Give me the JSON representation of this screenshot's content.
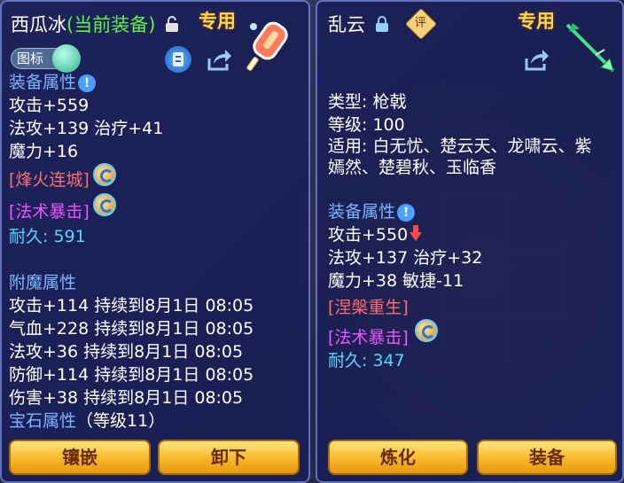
{
  "left_panel": {
    "title_name": "西瓜冰",
    "title_tag": "(当前装备)",
    "special_label": "专用",
    "chip_label": "图标",
    "section_attr": "装备属性",
    "stats": [
      "攻击+559",
      "法攻+139 治疗+41",
      "魔力+16"
    ],
    "skills": [
      "[烽火连城]",
      "[法术暴击]"
    ],
    "durability_label": "耐久:",
    "durability_value": "591",
    "section_enchant": "附魔属性",
    "enchants": [
      "攻击+114 持续到8月1日 08:05",
      "气血+228 持续到8月1日 08:05",
      "法攻+36 持续到8月1日 08:05",
      "防御+114 持续到8月1日 08:05",
      "伤害+38 持续到8月1日 08:05"
    ],
    "gem_label": "宝石属性",
    "gem_level": "（等级11）",
    "buttons": [
      "镶嵌",
      "卸下"
    ]
  },
  "right_panel": {
    "title_name": "乱云",
    "rating_badge": "评",
    "special_label": "专用",
    "type_line": "类型: 枪戟",
    "level_line": "等级: 100",
    "applies_line1": "适用: 白无忧、楚云天、龙啸云、紫",
    "applies_line2": "嫣然、楚碧秋、玉临香",
    "section_attr": "装备属性",
    "stats": [
      "攻击+550",
      "法攻+137 治疗+32",
      "魔力+38 敏捷-11"
    ],
    "skills": [
      "[涅槃重生]",
      "[法术暴击]"
    ],
    "durability_label": "耐久:",
    "durability_value": "347",
    "buttons": [
      "炼化",
      "装备"
    ]
  },
  "colors": {
    "accent_green": "#5ff24a",
    "header_blue": "#7db6ff",
    "value_cyan": "#58d6ff",
    "skill_red": "#ff6c6c",
    "skill_magenta": "#ee55ff",
    "button_gold": "#f7b728"
  },
  "icons": [
    "unlock-icon",
    "lock-icon",
    "scroll-icon",
    "share-icon",
    "info-icon",
    "skill-refresh-icon",
    "popsicle-weapon-icon",
    "spear-weapon-icon"
  ]
}
